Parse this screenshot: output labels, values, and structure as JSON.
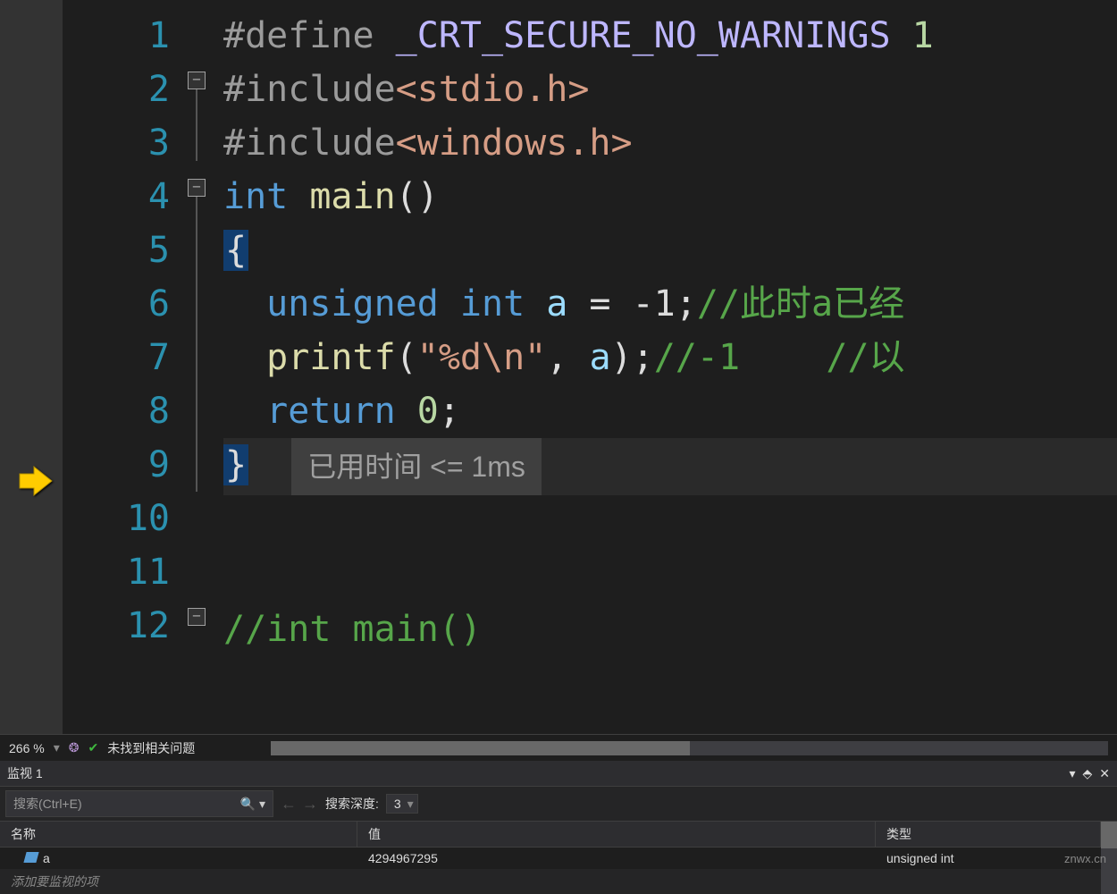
{
  "editor": {
    "lines": [
      "1",
      "2",
      "3",
      "4",
      "5",
      "6",
      "7",
      "8",
      "9",
      "10",
      "11",
      "12"
    ],
    "code": {
      "l1_define": "#define ",
      "l1_macro": "_CRT_SECURE_NO_WARNINGS",
      "l1_val": " 1",
      "l2_inc": "#include",
      "l2_hdr": "<stdio.h>",
      "l3_inc": "#include",
      "l3_hdr": "<windows.h>",
      "l4_ty": "int",
      "l4_fn": " main",
      "l4_paren": "()",
      "l5_brace": "{",
      "l6_kw": "unsigned int",
      "l6_var": " a",
      "l6_op": " = ",
      "l6_num": "-1",
      "l6_semi": ";",
      "l6_cmt": "//此时a已经",
      "l7_fn": "printf",
      "l7_p1": "(",
      "l7_str": "\"%d\\n\"",
      "l7_c": ", ",
      "l7_var": "a",
      "l7_p2": ");",
      "l7_cmt1": "//-1",
      "l7_cmt2": "    //以",
      "l8_kw": "return",
      "l8_val": " 0",
      "l8_semi": ";",
      "l9_brace": "}",
      "l9_perf": "已用时间 <= 1ms",
      "l12_cmt": "//int main()"
    }
  },
  "status": {
    "zoom": "266 %",
    "issues": "未找到相关问题"
  },
  "watch": {
    "title": "监视 1",
    "search_placeholder": "搜索(Ctrl+E)",
    "depth_label": "搜索深度:",
    "depth_value": "3",
    "col_name": "名称",
    "col_value": "值",
    "col_type": "类型",
    "row_name": "a",
    "row_value": "4294967295",
    "row_type": "unsigned int",
    "add_item": "添加要监视的项"
  },
  "watermark": "znwx.cn"
}
